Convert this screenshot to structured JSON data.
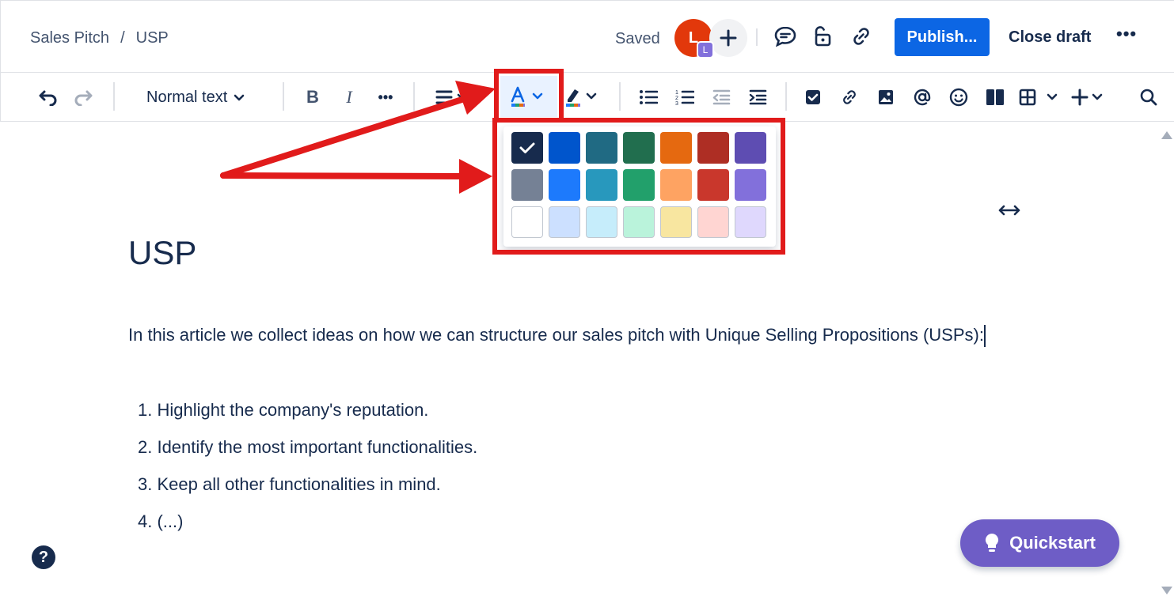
{
  "header": {
    "breadcrumb": [
      "Sales Pitch",
      "/",
      "USP"
    ],
    "saved_label": "Saved",
    "avatar_initial": "L",
    "avatar_badge": "L",
    "publish_label": "Publish...",
    "close_draft_label": "Close draft",
    "more_label": "•••"
  },
  "toolbar": {
    "text_style": "Normal text",
    "bold": "B",
    "italic": "I",
    "more": "•••"
  },
  "palette": {
    "selected": "#172b4d",
    "rows": [
      [
        "#172b4d",
        "#0055cc",
        "#206a83",
        "#216e4e",
        "#e56910",
        "#ae2e24",
        "#5e4db2"
      ],
      [
        "#758195",
        "#1d7afc",
        "#2898bd",
        "#22a06b",
        "#fea362",
        "#c9372c",
        "#8270db"
      ],
      [
        "#ffffff",
        "#cce0ff",
        "#c6edfb",
        "#baf3db",
        "#f8e6a0",
        "#ffd5d2",
        "#dfd8fd"
      ]
    ]
  },
  "document": {
    "title": "USP",
    "paragraph": "In this article we collect ideas on how we can structure our sales pitch with Unique Selling Propositions (USPs):",
    "list": [
      "1. Highlight the company's reputation.",
      "2. Identify the most important functionalities.",
      "3. Keep all other functionalities in mind.",
      "4. (...)"
    ]
  },
  "help_label": "?",
  "quickstart_label": "Quickstart",
  "colors": {
    "primary": "#0c66e4",
    "annotation": "#e11b1b",
    "quickstart": "#6e5dc6",
    "avatar": "#e2380b"
  }
}
